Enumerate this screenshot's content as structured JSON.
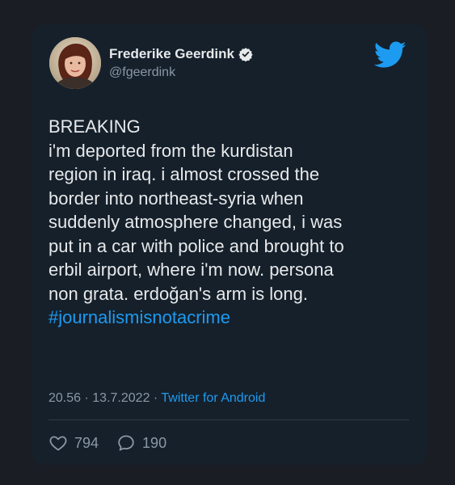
{
  "author": {
    "display_name": "Frederike Geerdink",
    "handle": "@fgeerdink",
    "verified": true
  },
  "tweet": {
    "lines": [
      "BREAKING",
      "i'm deported from the kurdistan",
      "region in iraq. i almost crossed the",
      "border into northeast-syria when",
      "suddenly atmosphere changed, i was",
      "put in a car with police and brought to",
      "erbil airport, where i'm now. persona",
      "non grata. erdoğan's arm is long."
    ],
    "hashtag": "#journalismisnotacrime"
  },
  "meta": {
    "time": "20.56",
    "separator": "·",
    "date": "13.7.2022",
    "source": "Twitter for Android"
  },
  "stats": {
    "likes": "794",
    "replies": "190"
  },
  "icons": {
    "brand": "twitter-bird-icon",
    "verified": "verified-badge-icon",
    "like": "heart-icon",
    "reply": "reply-bubble-icon"
  },
  "colors": {
    "card_background": "#15202b",
    "page_background": "#1b1d24",
    "accent": "#1d9bf0",
    "text_primary": "#e7e9ea",
    "text_secondary": "#8b98a5"
  }
}
